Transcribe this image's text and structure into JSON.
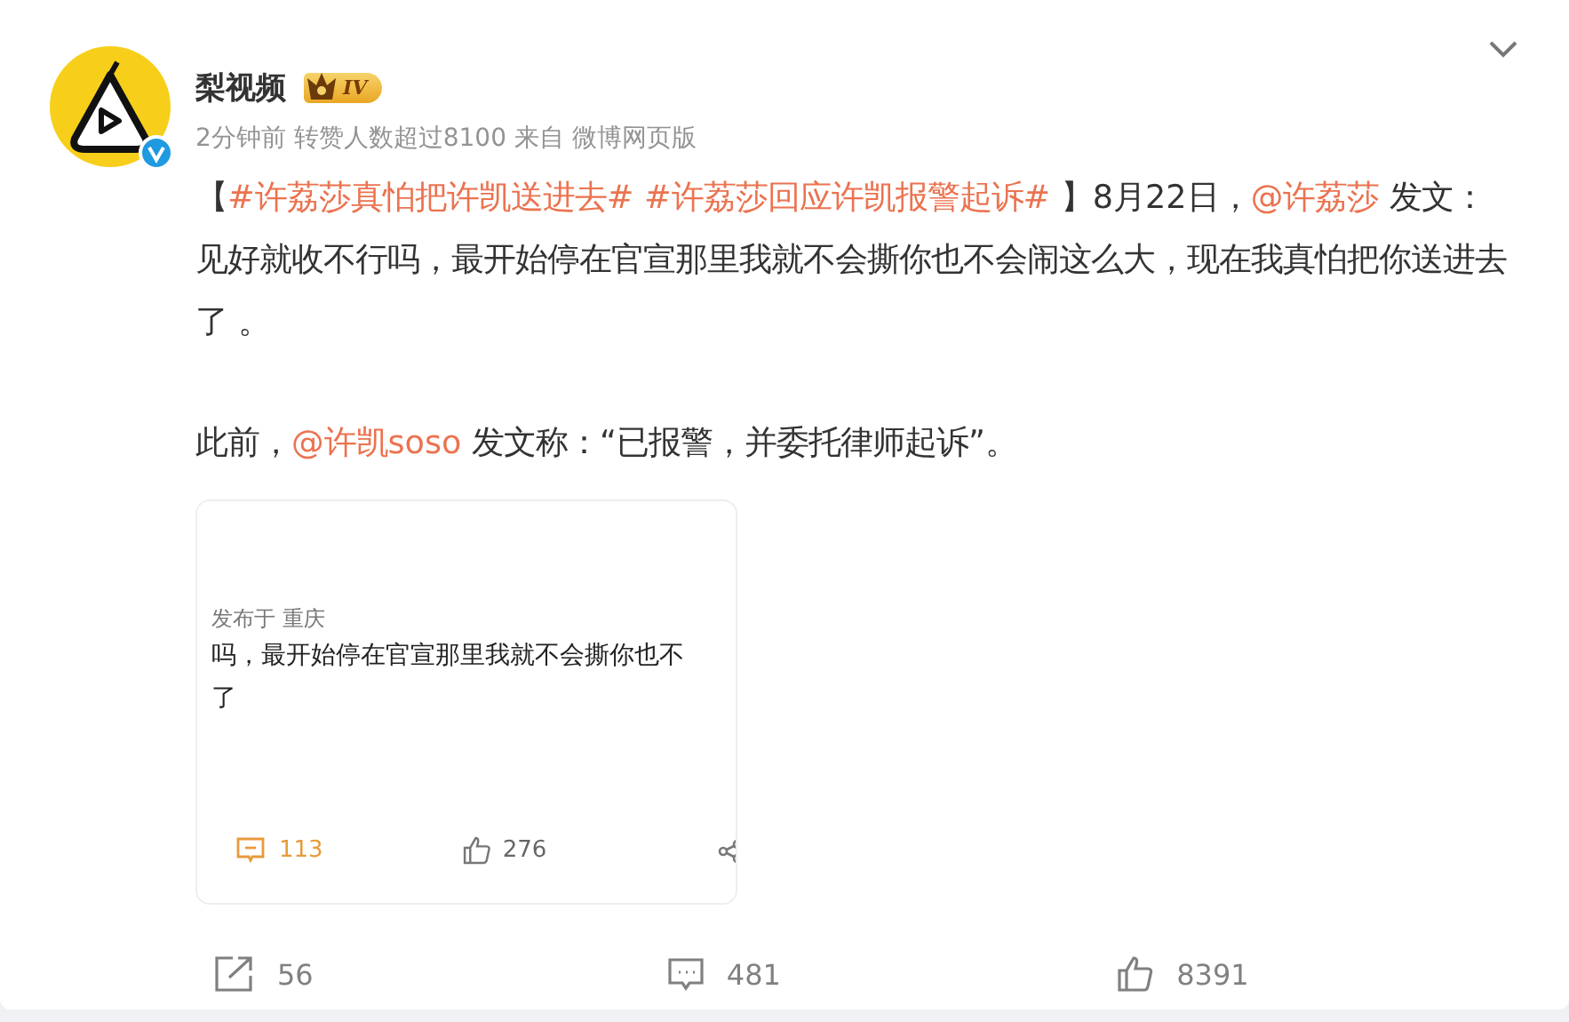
{
  "post": {
    "author": "梨视频",
    "badge": "IV",
    "meta": "2分钟前 转赞人数超过8100 来自 微博网页版",
    "paragraphs": [
      [
        {
          "kind": "plain",
          "text": "【"
        },
        {
          "kind": "topic",
          "text": "#许荔莎真怕把许凯送进去#"
        },
        {
          "kind": "topic",
          "text": " #许荔莎回应许凯报警起诉#"
        },
        {
          "kind": "plain",
          "text": " 】8月22日，"
        },
        {
          "kind": "mention",
          "text": "@许荔莎"
        },
        {
          "kind": "plain",
          "text": " 发文：见好就收不行吗，最开始停在官宣那里我就不会撕你也不会闹这么大，现在我真怕把你送进去了 。"
        }
      ],
      [
        {
          "kind": "plain",
          "text": "此前，"
        },
        {
          "kind": "mention",
          "text": "@许凯soso"
        },
        {
          "kind": "plain",
          "text": " 发文称：“已报警，并委托律师起诉”。"
        }
      ]
    ],
    "embedded_post": {
      "meta": "发布于 重庆",
      "lines": [
        "吗，最开始停在官宣那里我就不会撕你也不",
        "了"
      ],
      "comments": "113",
      "likes": "276"
    },
    "actions": [
      {
        "kind": "repost",
        "count": "56"
      },
      {
        "kind": "comment",
        "count": "481"
      },
      {
        "kind": "like",
        "count": "8391"
      }
    ]
  }
}
